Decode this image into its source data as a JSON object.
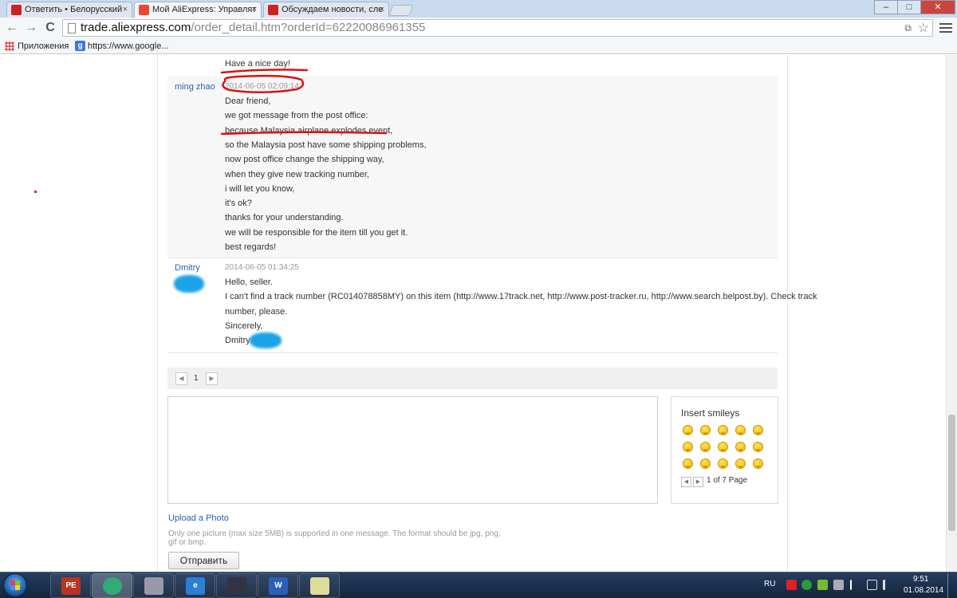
{
  "browser": {
    "tabs": [
      {
        "title": "Ответить • Белорусский",
        "active": false
      },
      {
        "title": "Мой AliExpress: Управлят",
        "active": true
      },
      {
        "title": "Обсуждаем новости, сле",
        "active": false
      }
    ],
    "tab_close": "×",
    "window_controls": {
      "minimize": "–",
      "maximize": "□",
      "close": "✕"
    },
    "nav": {
      "back": "←",
      "forward": "→",
      "reload": "C"
    },
    "url_host": "trade.aliexpress.com",
    "url_rest": "/order_detail.htm?orderId=62220086961355",
    "bookmarks": [
      {
        "label": "Приложения",
        "icon": "apps-grid-icon"
      },
      {
        "label": "https://www.google...",
        "icon": "google-icon"
      }
    ]
  },
  "messages": {
    "prev_tail": "Have a nice day!",
    "seller": {
      "author": "ming zhao",
      "time": "2014-06-05 02:09:14",
      "lines": [
        "Dear friend,",
        "we got message from the post office:",
        "because Malaysia airplane explodes event,",
        "so the Malaysia post have some shipping problems,",
        "now post office change the shipping way,",
        "when they give new tracking number,",
        "i will let you know,",
        "it's ok?",
        "thanks for your understanding.",
        "we will be responsible for the item till you get it.",
        "best regards!"
      ]
    },
    "buyer": {
      "author": "Dmitry",
      "time": "2014-06-05 01:34:25",
      "lines": [
        "Hello, seller.",
        "I can't find a track number (RC014078858MY) on this item (http://www.17track.net, http://www.post-tracker.ru, http://www.search.belpost.by). Check track",
        "number, please.",
        "Sincerely,",
        "Dmitry"
      ]
    }
  },
  "pager": {
    "prev": "◀",
    "page": "1",
    "next": "▶"
  },
  "smileys": {
    "title": "Insert smileys",
    "count": 15,
    "page_info": "1 of 7 Page",
    "prev": "◀",
    "next": "▶"
  },
  "upload": {
    "link": "Upload a Photo",
    "hint": "Only one picture (max size 5MB) is supported in one message. The format should be jpg, png, gif or bmp."
  },
  "send_button": "Отправить",
  "taskbar": {
    "items": [
      {
        "icon": "pe-explorer-icon",
        "label": "PE"
      },
      {
        "icon": "chrome-icon",
        "label": ""
      },
      {
        "icon": "calculator-icon",
        "label": ""
      },
      {
        "icon": "internet-explorer-icon",
        "label": "e"
      },
      {
        "icon": "floppy-disk-icon",
        "label": ""
      },
      {
        "icon": "word-icon",
        "label": "W"
      },
      {
        "icon": "paint-icon",
        "label": ""
      }
    ],
    "language": "RU",
    "clock_time": "9:51",
    "clock_date": "01.08.2014"
  }
}
